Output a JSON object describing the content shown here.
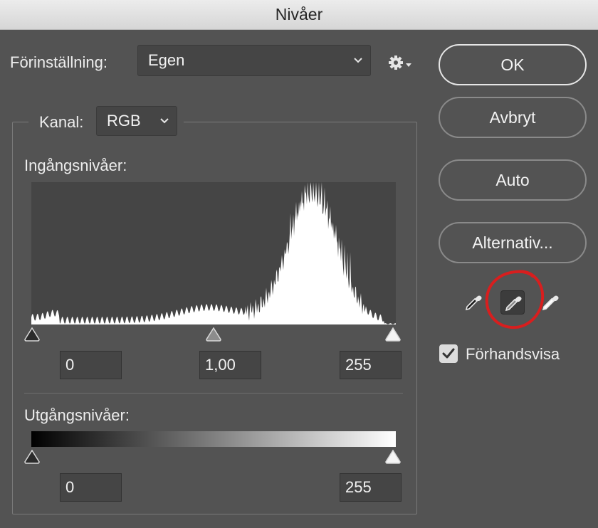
{
  "window": {
    "title": "Nivåer"
  },
  "preset": {
    "label": "Förinställning:",
    "value": "Egen",
    "menu_icon": "gear-icon"
  },
  "channel": {
    "label": "Kanal:",
    "value": "RGB"
  },
  "input_levels": {
    "label": "Ingångsnivåer:",
    "black": "0",
    "gamma": "1,00",
    "white": "255"
  },
  "output_levels": {
    "label": "Utgångsnivåer:",
    "black": "0",
    "white": "255"
  },
  "buttons": {
    "ok": "OK",
    "cancel": "Avbryt",
    "auto": "Auto",
    "options": "Alternativ..."
  },
  "eyedroppers": {
    "black": "eyedropper-black-icon",
    "gray": "eyedropper-gray-icon",
    "white": "eyedropper-white-icon",
    "selected": "gray"
  },
  "preview": {
    "label": "Förhandsvisa",
    "checked": true
  },
  "colors": {
    "dialog_bg": "#535353",
    "field_bg": "#454545",
    "annotation": "#d81e1e"
  }
}
